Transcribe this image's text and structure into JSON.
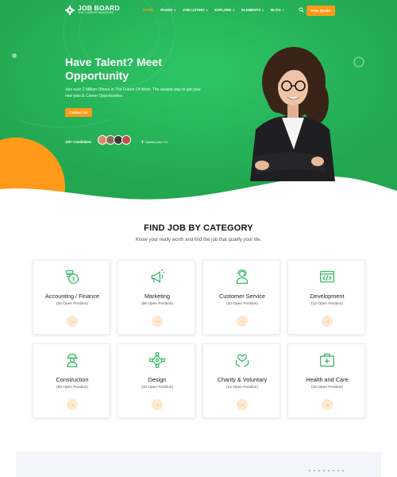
{
  "colors": {
    "hero_green": "#27b45a",
    "accent_orange": "#ff9a1a",
    "icon_green": "#27b45a"
  },
  "brand": {
    "title": "JOB BOARD",
    "subtitle": "THE CAREER MASTERS",
    "icon": "gear-icon"
  },
  "nav": {
    "items": [
      {
        "label": "HOME",
        "active": true,
        "dropdown": false
      },
      {
        "label": "PAGES",
        "active": false,
        "dropdown": true
      },
      {
        "label": "JOB LISTING",
        "active": false,
        "dropdown": true
      },
      {
        "label": "EXPLORE",
        "active": false,
        "dropdown": true
      },
      {
        "label": "ELEMENTS",
        "active": false,
        "dropdown": true
      },
      {
        "label": "BLOG",
        "active": false,
        "dropdown": true
      }
    ],
    "search_icon": "search-icon",
    "quote_label": "Free Quote"
  },
  "hero": {
    "title": "Have Talent? Meet Opportunity",
    "text": "Join over 2 Million Others in The Future Of Work. The easiest way to get your new jobs & Career Opportunities.",
    "cta_label": "Contact Us",
    "candidates_label": "10k+ Candidates",
    "upload_label": "Upload your CV"
  },
  "categories_section": {
    "title": "FIND JOB BY CATEGORY",
    "subtitle": "Know your really worth and find the job that qualify your life.",
    "categories": [
      {
        "name": "Accounting / Finance",
        "count": "(02 Open Position)",
        "icon": "money-bag-icon"
      },
      {
        "name": "Marketing",
        "count": "(86 Open Position)",
        "icon": "megaphone-icon"
      },
      {
        "name": "Customer Service",
        "count": "(20 Open Position)",
        "icon": "support-agent-icon"
      },
      {
        "name": "Development",
        "count": "(12 Open Position)",
        "icon": "code-window-icon"
      },
      {
        "name": "Construction",
        "count": "(55 Open Position)",
        "icon": "worker-icon"
      },
      {
        "name": "Design",
        "count": "(43 Open Position)",
        "icon": "pen-tool-icon"
      },
      {
        "name": "Charity & Voluntary",
        "count": "(12 Open Position)",
        "icon": "heart-hands-icon"
      },
      {
        "name": "Health and Care",
        "count": "(25 Open Position)",
        "icon": "medical-kit-icon"
      }
    ]
  }
}
